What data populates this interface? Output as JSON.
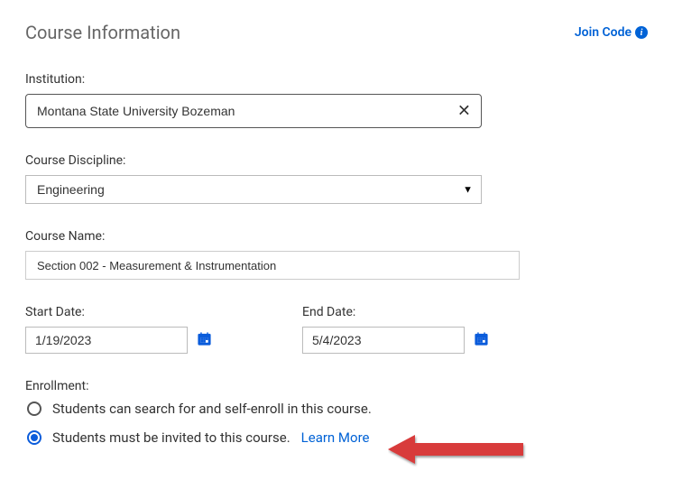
{
  "header": {
    "title": "Course Information",
    "join_code": "Join Code"
  },
  "institution": {
    "label": "Institution:",
    "value": "Montana State University Bozeman"
  },
  "discipline": {
    "label": "Course Discipline:",
    "value": "Engineering"
  },
  "course_name": {
    "label": "Course Name:",
    "value": "Section 002 - Measurement & Instrumentation"
  },
  "start_date": {
    "label": "Start Date:",
    "value": "1/19/2023"
  },
  "end_date": {
    "label": "End Date:",
    "value": "5/4/2023"
  },
  "enrollment": {
    "label": "Enrollment:",
    "option_self": "Students can search for and self-enroll in this course.",
    "option_invite": "Students must be invited to this course.",
    "learn_more": "Learn More"
  }
}
